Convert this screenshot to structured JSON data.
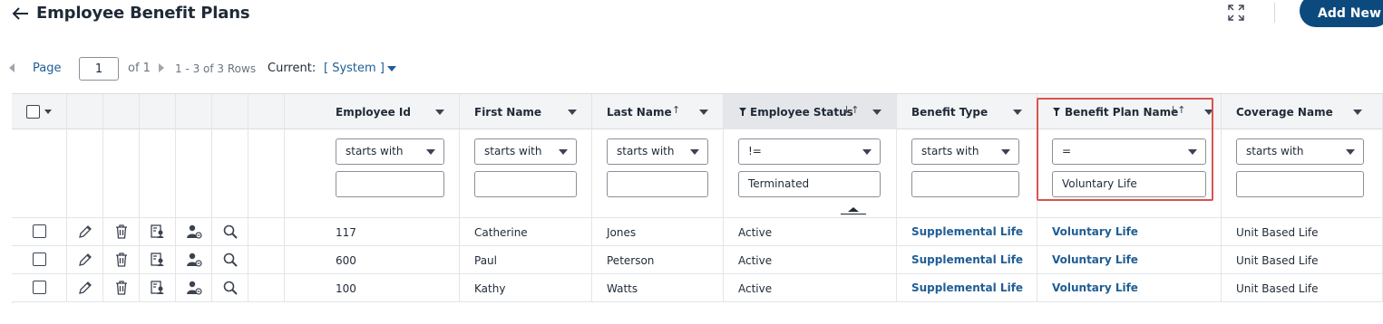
{
  "header": {
    "title": "Employee Benefit Plans",
    "add_new_label": "Add New"
  },
  "pager": {
    "page_label": "Page",
    "page_value": "1",
    "of_text": "of 1",
    "rows_text": "1 - 3 of 3 Rows",
    "current_label": "Current:",
    "current_value": "[ System ]"
  },
  "columns": [
    {
      "key": "employee_id",
      "label": "Employee Id",
      "filter_op": "starts with",
      "filter_value": ""
    },
    {
      "key": "first_name",
      "label": "First Name",
      "filter_op": "starts with",
      "filter_value": ""
    },
    {
      "key": "last_name",
      "label": "Last Name",
      "sort": "↑",
      "filter_op": "starts with",
      "filter_value": ""
    },
    {
      "key": "employee_status",
      "label": "Employee Status",
      "sort": "↓↑",
      "filtered": true,
      "filter_op": "!=",
      "filter_value": "Terminated"
    },
    {
      "key": "benefit_type",
      "label": "Benefit Type",
      "filter_op": "starts with",
      "filter_value": ""
    },
    {
      "key": "benefit_plan_name",
      "label": "Benefit Plan Name",
      "sort": "↓↑",
      "filtered": true,
      "filter_op": "=",
      "filter_value": "Voluntary Life"
    },
    {
      "key": "coverage_name",
      "label": "Coverage Name",
      "filter_op": "starts with",
      "filter_value": ""
    }
  ],
  "rows": [
    {
      "employee_id": "117",
      "first_name": "Catherine",
      "last_name": "Jones",
      "employee_status": "Active",
      "benefit_type": "Supplemental Life",
      "benefit_plan_name": "Voluntary Life",
      "coverage_name": "Unit Based Life"
    },
    {
      "employee_id": "600",
      "first_name": "Paul",
      "last_name": "Peterson",
      "employee_status": "Active",
      "benefit_type": "Supplemental Life",
      "benefit_plan_name": "Voluntary Life",
      "coverage_name": "Unit Based Life"
    },
    {
      "employee_id": "100",
      "first_name": "Kathy",
      "last_name": "Watts",
      "employee_status": "Active",
      "benefit_type": "Supplemental Life",
      "benefit_plan_name": "Voluntary Life",
      "coverage_name": "Unit Based Life"
    }
  ],
  "row_actions": [
    "edit-icon",
    "trash-icon",
    "details-icon",
    "assign-user-icon",
    "search-icon"
  ],
  "colors": {
    "accent": "#0c4a7e",
    "link": "#1f5d95",
    "highlight": "#d9534f"
  }
}
